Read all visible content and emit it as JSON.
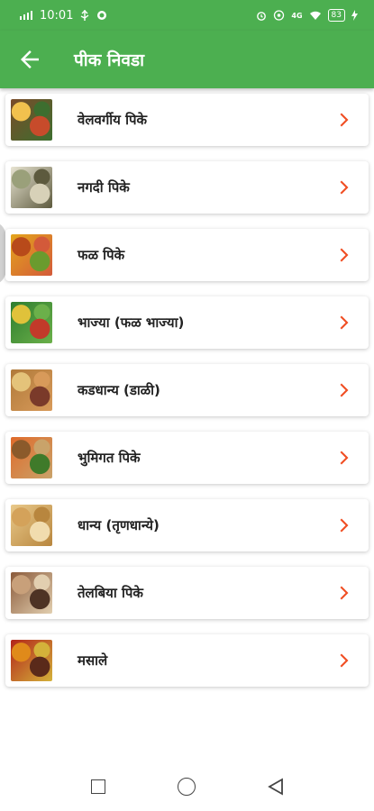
{
  "status_bar": {
    "time": "10:01",
    "battery": "83",
    "network_label": "4G"
  },
  "app_bar": {
    "title": "पीक निवडा"
  },
  "crops": [
    {
      "label": "वेलवर्गीय पिके",
      "image_icon": "vine-crops-image",
      "colors": [
        "#7a4b2a",
        "#f2c14e",
        "#c74b2b",
        "#3d6e2f"
      ]
    },
    {
      "label": "नगदी पिके",
      "image_icon": "cash-crops-image",
      "colors": [
        "#e8e4d2",
        "#9aa07a",
        "#d7d1b8",
        "#5d5a3e"
      ]
    },
    {
      "label": "फळ पिके",
      "image_icon": "fruit-crops-image",
      "colors": [
        "#e4a51c",
        "#b84a1a",
        "#6a9b2e",
        "#d35a3a"
      ]
    },
    {
      "label": "भाज्या (फळ भाज्या)",
      "image_icon": "vegetables-image",
      "colors": [
        "#2e7d2e",
        "#e0c23a",
        "#c23a2a",
        "#6bb04a"
      ]
    },
    {
      "label": "कडधान्य (डाळी)",
      "image_icon": "pulses-image",
      "colors": [
        "#b07a3a",
        "#e4c37a",
        "#7a3a2a",
        "#d89a5a"
      ]
    },
    {
      "label": "भुमिगत पिके",
      "image_icon": "root-crops-image",
      "colors": [
        "#e06a2a",
        "#8b5a2b",
        "#3f7a2a",
        "#c9a36a"
      ]
    },
    {
      "label": "धान्य (तृणधान्ये)",
      "image_icon": "cereals-image",
      "colors": [
        "#e9c98a",
        "#d4a25a",
        "#f1dcae",
        "#b8863e"
      ]
    },
    {
      "label": "तेलबिया पिके",
      "image_icon": "oilseeds-image",
      "colors": [
        "#8a5a3a",
        "#c8a07a",
        "#4e3324",
        "#e2cfb0"
      ]
    },
    {
      "label": "मसाले",
      "image_icon": "spices-image",
      "colors": [
        "#b2241a",
        "#e08a1a",
        "#5a2a1a",
        "#d4b23a"
      ]
    }
  ],
  "accent_color": "#4caf50",
  "chevron_color": "#f04e23"
}
